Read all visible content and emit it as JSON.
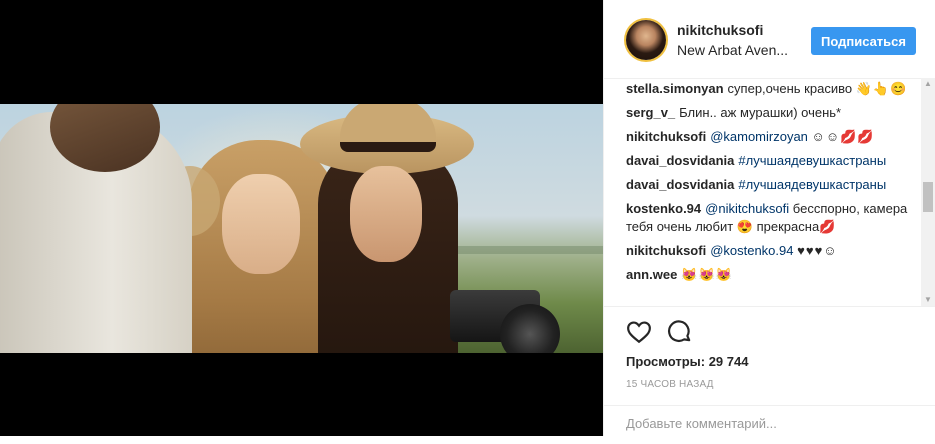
{
  "post": {
    "username": "nikitchuksofi",
    "location": "New Arbat Aven...",
    "follow_label": "Подписаться"
  },
  "comments": [
    {
      "user": "stella.simonyan",
      "text": "супер,очень красиво",
      "emoji": "👋👆😊"
    },
    {
      "user": "serg_v_",
      "text": "Блин.. аж мурашки) очень*"
    },
    {
      "user": "nikitchuksofi",
      "mention": "@kamomirzoyan",
      "emoji": "☺☺💋💋"
    },
    {
      "user": "davai_dosvidania",
      "mention": "#лучшаядевушкастраны"
    },
    {
      "user": "davai_dosvidania",
      "mention": "#лучшаядевушкастраны"
    },
    {
      "user": "kostenko.94",
      "mention": "@nikitchuksofi",
      "text": "бесспорно, камера тебя очень любит 😍 прекрасна💋"
    },
    {
      "user": "nikitchuksofi",
      "mention": "@kostenko.94",
      "emoji": "♥♥♥☺"
    },
    {
      "user": "ann.wee",
      "emoji": "😻😻😻"
    }
  ],
  "stats": {
    "views": "Просмотры: 29 744",
    "time": "15 ЧАСОВ НАЗАД"
  },
  "add_comment": {
    "placeholder": "Добавьте комментарий..."
  },
  "icons": {
    "like": "heart-icon",
    "comment": "comment-bubble-icon"
  },
  "colors": {
    "follow_button": "#3897f0",
    "link": "#003569",
    "secondary_text": "#999999"
  }
}
